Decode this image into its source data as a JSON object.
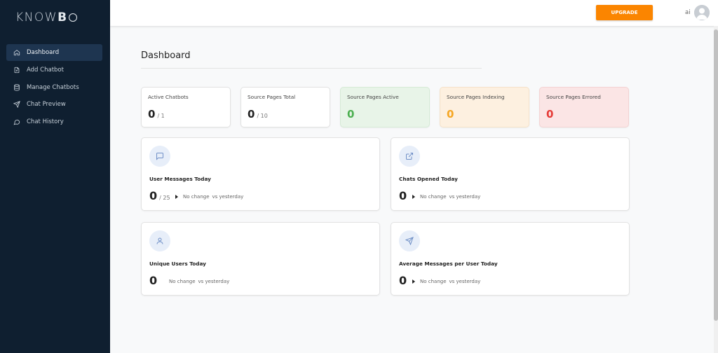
{
  "logo": {
    "prefix": "KNOW",
    "bold": "B"
  },
  "sidebar": {
    "items": [
      {
        "label": "Dashboard",
        "icon": "home-icon",
        "active": true
      },
      {
        "label": "Add Chatbot",
        "icon": "file-plus-icon",
        "active": false
      },
      {
        "label": "Manage Chatbots",
        "icon": "database-icon",
        "active": false
      },
      {
        "label": "Chat Preview",
        "icon": "send-icon",
        "active": false
      },
      {
        "label": "Chat History",
        "icon": "chat-bubble-icon",
        "active": false
      }
    ]
  },
  "topbar": {
    "upgrade_label": "UPGRADE",
    "user_name": "ai",
    "accent_color": "#fb8500"
  },
  "main": {
    "title": "Dashboard",
    "stats": [
      {
        "label": "Active Chatbots",
        "value": "0",
        "total": "/ 1",
        "tone": "white"
      },
      {
        "label": "Source Pages Total",
        "value": "0",
        "total": "/ 10",
        "tone": "white"
      },
      {
        "label": "Source Pages Active",
        "value": "0",
        "total": "",
        "tone": "green"
      },
      {
        "label": "Source Pages Indexing",
        "value": "0",
        "total": "",
        "tone": "orange"
      },
      {
        "label": "Source Pages Errored",
        "value": "0",
        "total": "",
        "tone": "red"
      }
    ],
    "cards": [
      {
        "label": "User Messages Today",
        "value": "0",
        "total": "/ 25",
        "change": "No change",
        "vs": "vs yesterday",
        "icon": "message-square-icon",
        "arrow": true
      },
      {
        "label": "Chats Opened Today",
        "value": "0",
        "total": "",
        "change": "No change",
        "vs": "vs yesterday",
        "icon": "external-link-icon",
        "arrow": true
      },
      {
        "label": "Unique Users Today",
        "value": "0",
        "total": "",
        "change": "No change",
        "vs": "vs yesterday",
        "icon": "user-icon",
        "arrow": false
      },
      {
        "label": "Average Messages per User Today",
        "value": "0",
        "total": "",
        "change": "No change",
        "vs": "vs yesterday",
        "icon": "send-icon",
        "arrow": true
      }
    ]
  },
  "colors": {
    "sidebar_bg": "#0f1f30",
    "active_bg": "#1e3550",
    "green": "#4caf50",
    "orange": "#f5a623",
    "red": "#e53935"
  }
}
